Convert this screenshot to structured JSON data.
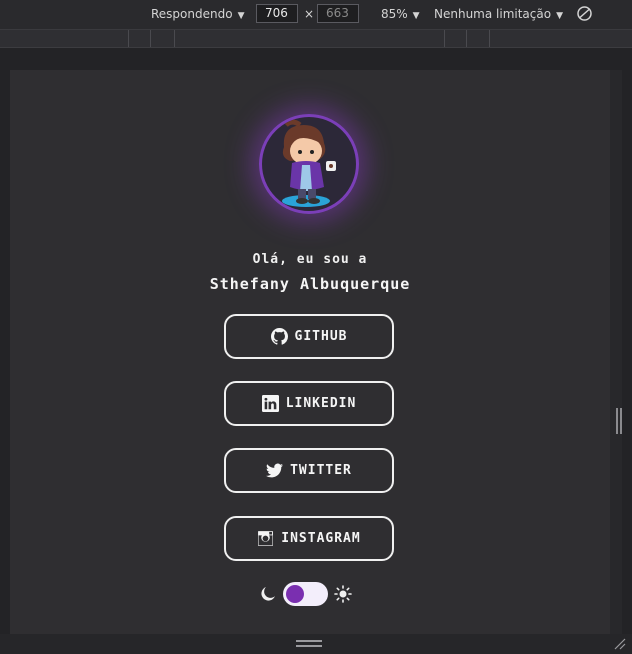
{
  "toolbar": {
    "device_mode": "Respondendo",
    "width_value": "706",
    "height_placeholder": "663",
    "times": "×",
    "zoom": "85%",
    "throttling": "Nenhuma limitação",
    "arrow": "▼"
  },
  "profile": {
    "greeting": "Olá, eu sou a",
    "name": "Sthefany Albuquerque",
    "links": [
      {
        "label": "GITHUB",
        "icon": "github-icon"
      },
      {
        "label": "LINKEDIN",
        "icon": "linkedin-icon"
      },
      {
        "label": "TWITTER",
        "icon": "twitter-icon"
      },
      {
        "label": "INSTAGRAM",
        "icon": "instagram-icon"
      }
    ]
  },
  "theme": {
    "left_icon": "moon-icon",
    "right_icon": "sun-icon",
    "accent": "#7a2fb0"
  }
}
